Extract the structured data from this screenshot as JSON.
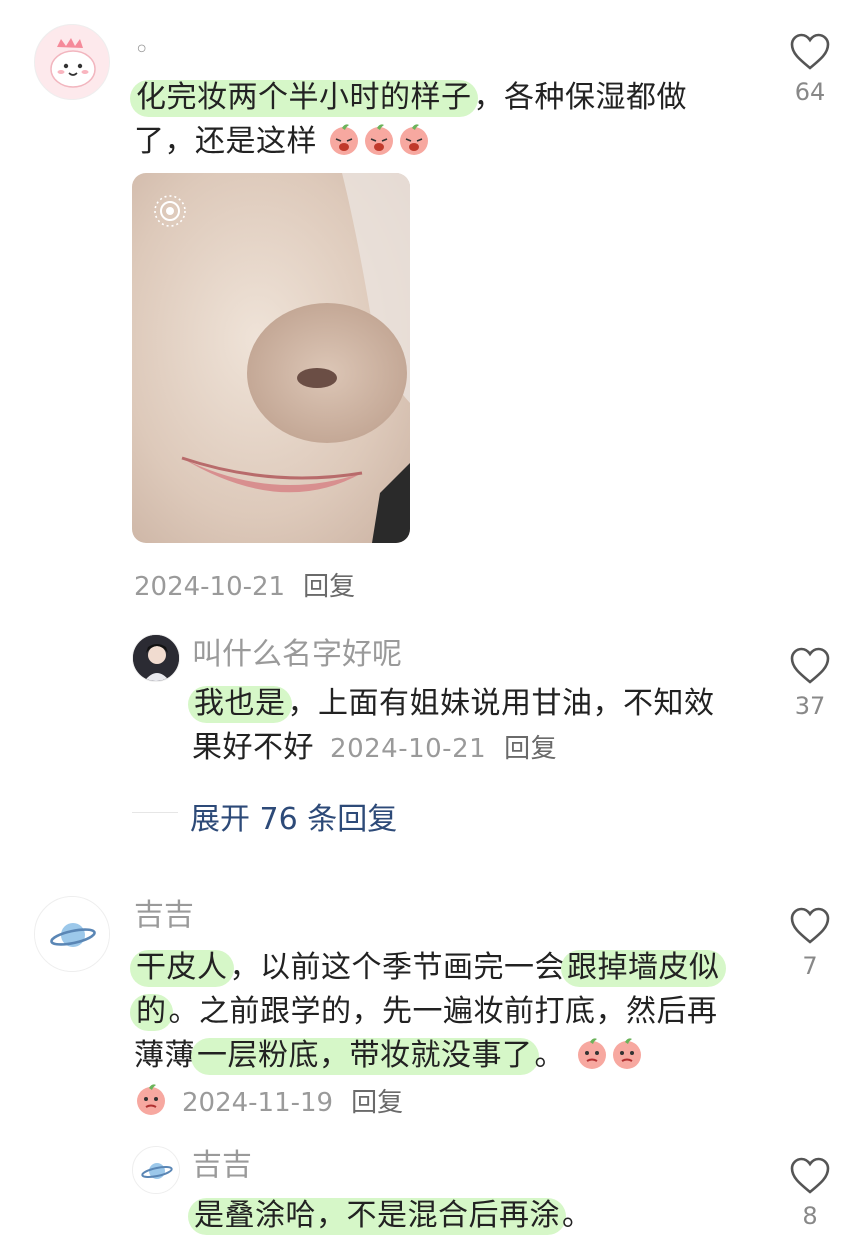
{
  "comments": [
    {
      "username": "◦",
      "text_highlight": "化完妆两个半小时的样子",
      "text_rest": "，各种保湿都做了，还是这样",
      "emojis": [
        "crying-peach-emoji",
        "crying-peach-emoji",
        "crying-peach-emoji"
      ],
      "date": "2024-10-21",
      "reply_label": "回复",
      "likes": "64"
    },
    {
      "username": "吉吉",
      "parts": [
        "干皮人",
        "，以前这个季节画完一会",
        "跟掉墙皮似的",
        "。之前跟学的，先一遍妆前打底，然后再薄薄",
        "一层粉底，带妆就没事了",
        "。"
      ],
      "emojis": [
        "smirk-peach-emoji",
        "smirk-peach-emoji",
        "smirk-peach-emoji"
      ],
      "date": "2024-11-19",
      "reply_label": "回复",
      "likes": "7"
    }
  ],
  "replies": [
    {
      "username": "叫什么名字好呢",
      "text_highlight": "我也是",
      "text_rest": "，上面有姐妹说用甘油，不知效果好不好",
      "date": "2024-10-21",
      "reply_label": "回复",
      "likes": "37"
    },
    {
      "username": "吉吉",
      "text_highlight": "是叠涂哈，不是混合后再涂",
      "text_rest": "。",
      "likes": "8"
    }
  ],
  "expand": {
    "label": "展开 76 条回复"
  },
  "colors": {
    "highlight": "#d6f7c8",
    "link": "#2d4a78",
    "muted": "#9a9a9a"
  }
}
